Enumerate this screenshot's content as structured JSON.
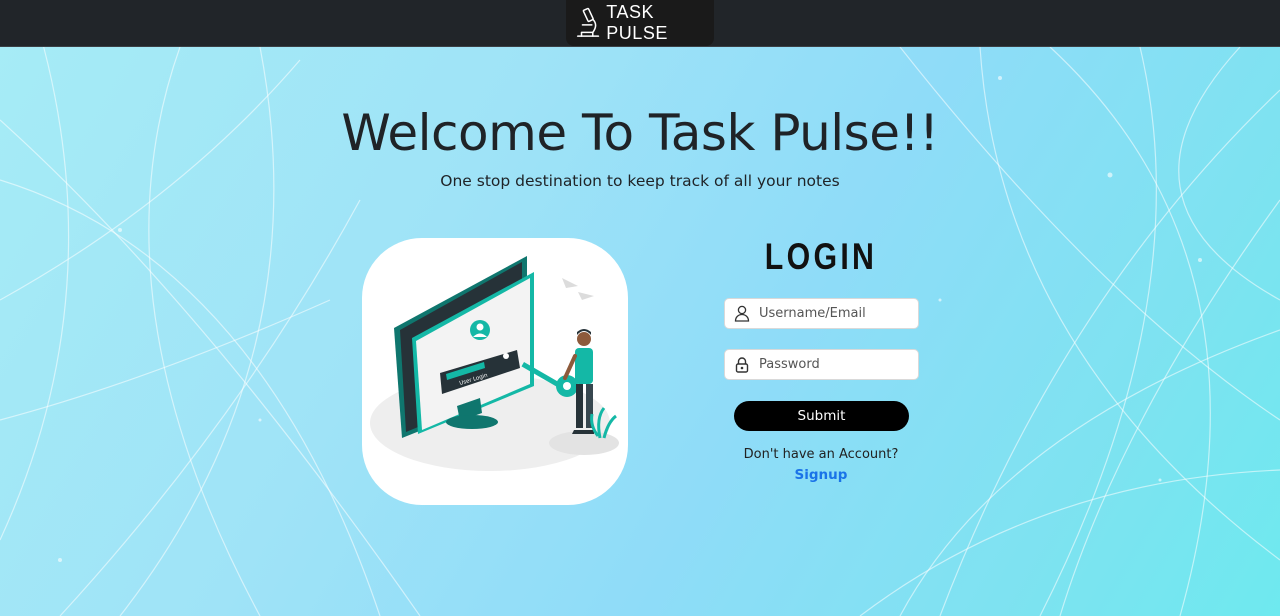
{
  "navbar": {
    "brand_text": "TASK PULSE",
    "brand_icon": "microscope-icon",
    "background": "#212529"
  },
  "hero": {
    "title": "Welcome To Task Pulse!!",
    "subtitle": "One stop destination to keep track of all your notes"
  },
  "illustration": {
    "screen_label": "User Login",
    "accent": "#14b8a6"
  },
  "login": {
    "title": "LOGIN",
    "username_placeholder": "Username/Email",
    "password_placeholder": "Password",
    "username_icon": "user-icon",
    "password_icon": "lock-icon",
    "submit_label": "Submit",
    "signup_prompt": "Don't have an Account?",
    "signup_link": "Signup",
    "link_color": "#1a73e8"
  }
}
